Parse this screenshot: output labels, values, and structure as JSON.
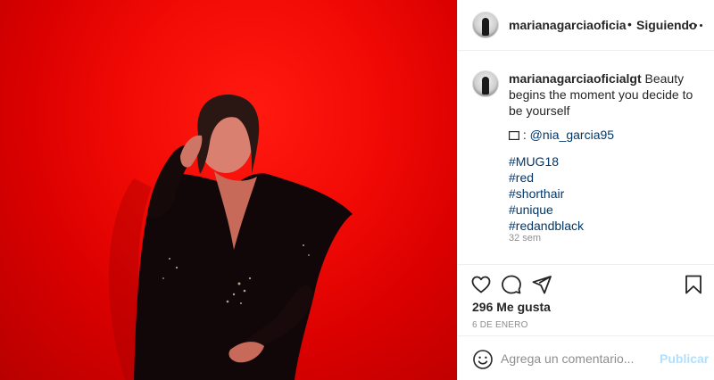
{
  "header": {
    "username": "marianagarciaoficia",
    "separator": "•",
    "follow_status": "Siguiendo"
  },
  "post": {
    "caption_user": "marianagarciaoficialgt",
    "caption_text": " Beauty begins the moment you decide to be yourself",
    "camera_glyph": "📷",
    "photo_credit": "@nia_garcia95",
    "hashtags": [
      "#MUG18",
      "#red",
      "#shorthair",
      "#unique",
      "#redandblack"
    ],
    "time_ago": "32 sem"
  },
  "actions": {
    "likes": "296 Me gusta",
    "date": "6 DE ENERO"
  },
  "comment_box": {
    "placeholder": "Agrega un comentario...",
    "publish_label": "Publicar"
  },
  "icons": [
    "avatar",
    "more-icon",
    "heart-icon",
    "comment-icon",
    "share-icon",
    "bookmark-icon",
    "emoji-icon"
  ],
  "colors": {
    "background_red": "#e00000",
    "link": "#00376b",
    "publish_disabled": "#b2dffc",
    "muted": "#8e8e8e"
  }
}
